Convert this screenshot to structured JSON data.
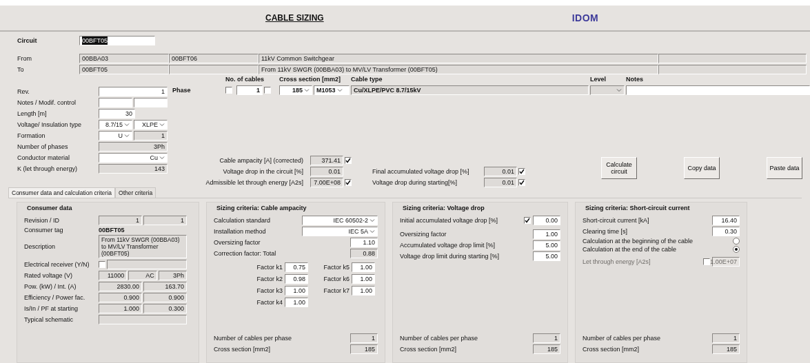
{
  "header": {
    "title": "CABLE SIZING",
    "logo": "IDOM"
  },
  "circuit": {
    "label": "Circuit",
    "value": "00BFT05"
  },
  "from": {
    "label": "From",
    "code": "00BBA03",
    "code_2": "00BFT06",
    "description": "11kV Common Switchgear"
  },
  "to": {
    "label": "To",
    "code": "00BFT05",
    "description": "From 11kV SWGR (00BBA03) to MV/LV Transformer (00BFT05)"
  },
  "properties": [
    {
      "label": "Rev.",
      "fields": [
        {
          "kind": "input",
          "value": "1"
        }
      ]
    },
    {
      "label": "Notes / Modif. control",
      "fields": [
        {
          "kind": "input"
        },
        {
          "kind": "input"
        }
      ]
    },
    {
      "label": "Length [m]",
      "fields": [
        {
          "kind": "input",
          "value": "30"
        },
        {
          "kind": "blank"
        }
      ]
    },
    {
      "label": "Voltage/ Insulation type",
      "fields": [
        {
          "kind": "select",
          "value": "8.7/15"
        },
        {
          "kind": "select",
          "value": "XLPE"
        }
      ]
    },
    {
      "label": "Formation",
      "fields": [
        {
          "kind": "select",
          "value": "U"
        },
        {
          "kind": "readonly",
          "value": "1"
        }
      ]
    },
    {
      "label": "Number of phases",
      "fields": [
        {
          "kind": "readonly",
          "value": "3Ph"
        }
      ]
    },
    {
      "label": "Conductor material",
      "fields": [
        {
          "kind": "select",
          "value": "Cu"
        }
      ]
    },
    {
      "label": "K (let through energy)",
      "fields": [
        {
          "kind": "readonly",
          "value": "143"
        }
      ]
    }
  ],
  "phase": {
    "label": "Phase",
    "headers": [
      "No. of cables",
      "Cross section [mm2]",
      "Cable type",
      "Level",
      "Notes"
    ],
    "cables_checked": false,
    "cables": "1",
    "section_checked": false,
    "section": "185",
    "cable_code": "M1053",
    "cable_type": "Cu/XLPE/PVC 8.7/15kV"
  },
  "results": [
    {
      "label": "Cable ampacity [A] (corrected)",
      "value": "371.41",
      "checked": true
    },
    {
      "label": "Voltage drop in the circuit [%]",
      "value": "0.01"
    },
    {
      "label": "Admissible let through energy [A2s]",
      "value": "7.00E+08",
      "checked": true
    }
  ],
  "results_2": [
    {
      "label": "Final accumulated voltage drop [%]",
      "value": "0.01",
      "checked": true
    },
    {
      "label": "Voltage drop during starting[%]",
      "value": "0.01",
      "checked": true
    }
  ],
  "buttons": [
    "Calculate circuit",
    "Copy data",
    "Paste data"
  ],
  "tabs": [
    {
      "label": "Consumer data and calculation criteria",
      "selected": true
    },
    {
      "label": "Other criteria",
      "selected": false
    }
  ],
  "panels": [
    {
      "title": "Consumer data",
      "sections": [
        [
          {
            "label": "Revision / ID",
            "fields": [
              {
                "kind": "readonly",
                "value": "1"
              },
              {
                "kind": "readonly",
                "value": "1"
              }
            ]
          },
          {
            "label": "Consumer tag",
            "fields": [
              {
                "kind": "text",
                "value": "00BFT05"
              }
            ]
          },
          {
            "label": "Description",
            "fields": [
              {
                "kind": "multiline",
                "value": "From 11kV SWGR (00BBA03) to MV/LV Transformer (00BFT05)"
              }
            ]
          },
          {
            "label": "Electrical receiver (Y/N)",
            "fields": [
              {
                "kind": "check",
                "checked": false
              },
              {
                "kind": "readonly"
              }
            ]
          },
          {
            "label": "Rated voltage  (V)",
            "fields": [
              {
                "kind": "readonly",
                "value": "11000"
              },
              {
                "kind": "readonly",
                "value": "AC"
              },
              {
                "kind": "readonly",
                "value": "3Ph"
              }
            ]
          },
          {
            "label": "Pow. (kW) / Int. (A)",
            "fields": [
              {
                "kind": "readonly",
                "value": "2830.00"
              },
              {
                "kind": "readonly",
                "value": "163.70"
              }
            ]
          },
          {
            "label": "Efficiency / Power fac.",
            "fields": [
              {
                "kind": "readonly",
                "value": "0.900"
              },
              {
                "kind": "readonly",
                "value": "0.900"
              }
            ]
          },
          {
            "label": "Is/In / PF at starting",
            "fields": [
              {
                "kind": "readonly",
                "value": "1.000"
              },
              {
                "kind": "readonly",
                "value": "0.300"
              }
            ]
          },
          {
            "label": "Typical schematic",
            "fields": [
              {
                "kind": "readonly"
              }
            ]
          }
        ]
      ]
    },
    {
      "title": "Sizing criteria: Cable ampacity",
      "sections": [
        [
          {
            "label": "Calculation standard",
            "fields": [
              {
                "kind": "select",
                "value": "IEC 60502-2"
              }
            ]
          },
          {
            "label": "Installation method",
            "fields": [
              {
                "kind": "select",
                "value": "IEC 5A"
              }
            ]
          },
          {
            "label": "Oversizing factor",
            "fields": [
              {
                "kind": "input",
                "value": "1.10"
              }
            ]
          },
          {
            "label": "Correction factor: Total",
            "fields": [
              {
                "kind": "readonly",
                "value": "0.88"
              }
            ]
          }
        ],
        [
          {
            "label": "Number of cables per phase",
            "fields": [
              {
                "kind": "readonly",
                "value": "1"
              }
            ]
          },
          {
            "label": "Cross section [mm2]",
            "fields": [
              {
                "kind": "readonly",
                "value": "185"
              }
            ]
          }
        ]
      ],
      "factors": [
        {
          "label": "Factor k1",
          "value": "0.75"
        },
        {
          "label": "Factor k2",
          "value": "0.98"
        },
        {
          "label": "Factor k3",
          "value": "1.00"
        },
        {
          "label": "Factor k4",
          "value": "1.00"
        },
        {
          "label": "Factor k5",
          "value": "1.00"
        },
        {
          "label": "Factor k6",
          "value": "1.00"
        },
        {
          "label": "Factor k7",
          "value": "1.00"
        }
      ]
    },
    {
      "title": "Sizing criteria: Voltage drop",
      "sections": [
        [
          {
            "label": "Initial accumulated voltage drop [%]",
            "fields": [
              {
                "kind": "check",
                "checked": true
              },
              {
                "kind": "input",
                "value": "0.00"
              }
            ]
          }
        ],
        [
          {
            "label": "Oversizing factor",
            "fields": [
              {
                "kind": "input",
                "value": "1.00"
              }
            ]
          },
          {
            "label": "Accumulated voltage drop limit [%]",
            "fields": [
              {
                "kind": "input",
                "value": "5.00"
              }
            ]
          },
          {
            "label": "Voltage drop limit during starting [%]",
            "fields": [
              {
                "kind": "input",
                "value": "5.00"
              }
            ]
          }
        ],
        [
          {
            "label": "Number of cables per phase",
            "fields": [
              {
                "kind": "readonly",
                "value": "1"
              }
            ]
          },
          {
            "label": "Cross section [mm2]",
            "fields": [
              {
                "kind": "readonly",
                "value": "185"
              }
            ]
          }
        ]
      ]
    },
    {
      "title": "Sizing criteria: Short-circuit current",
      "sections": [
        [
          {
            "label": "Short-circuit current [kA]",
            "disabled": false,
            "fields": [
              {
                "kind": "input",
                "value": "16.40"
              }
            ]
          },
          {
            "label": "Clearing time [s]",
            "disabled": false,
            "fields": [
              {
                "kind": "input",
                "value": "0.30"
              }
            ]
          },
          {
            "label": "Calculation at the beginning of the cable",
            "disabled": false,
            "fields": [
              {
                "kind": "radio",
                "checked": false
              }
            ]
          },
          {
            "label": "Calculation at the end of the cable",
            "disabled": false,
            "fields": [
              {
                "kind": "radio",
                "checked": true
              }
            ]
          }
        ],
        [
          {
            "label": "Let through energy [A2s]",
            "disabled": true,
            "fields": [
              {
                "kind": "check",
                "checked": false
              },
              {
                "kind": "readonly",
                "value": "1.00E+07"
              }
            ]
          }
        ],
        [
          {
            "label": "Number of cables per phase",
            "disabled": false,
            "fields": [
              {
                "kind": "readonly",
                "value": "1"
              }
            ]
          },
          {
            "label": "Cross section [mm2]",
            "disabled": false,
            "fields": [
              {
                "kind": "readonly",
                "value": "185"
              }
            ]
          }
        ]
      ]
    }
  ]
}
